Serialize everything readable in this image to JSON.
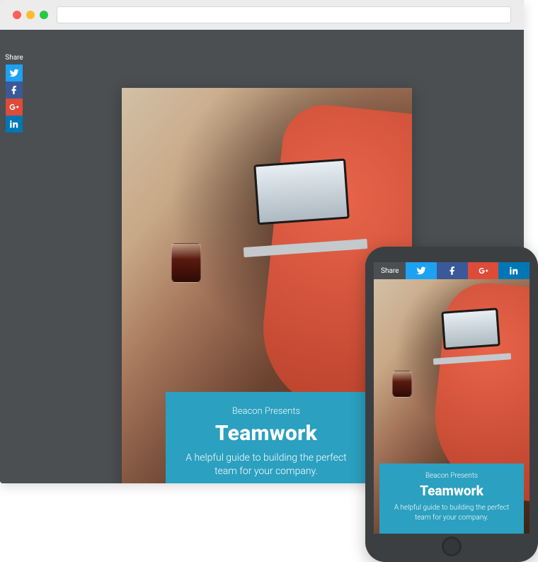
{
  "share": {
    "label": "Share",
    "buttons": {
      "twitter": "twitter-icon",
      "facebook": "facebook-icon",
      "googleplus": "googleplus-icon",
      "linkedin": "linkedin-icon"
    }
  },
  "card": {
    "pretitle": "Beacon Presents",
    "title": "Teamwork",
    "subtitle": "A helpful guide to building the perfect team for your company."
  },
  "colors": {
    "accent": "#2ba0c0",
    "twitter": "#1da1f2",
    "facebook": "#3b5998",
    "googleplus": "#dd4b39",
    "linkedin": "#0077b5",
    "chrome_frame": "#4b4f52"
  }
}
